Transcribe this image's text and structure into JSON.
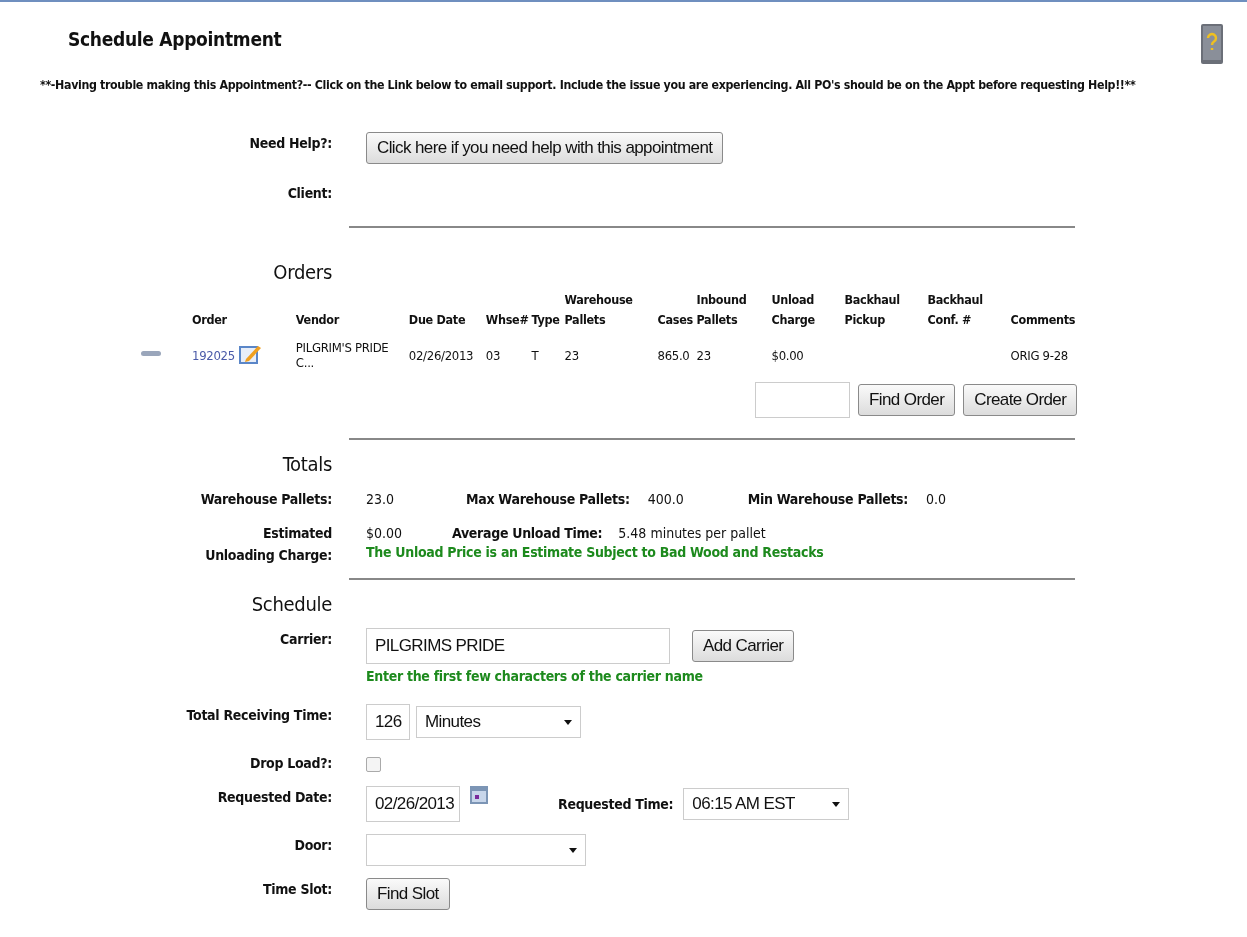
{
  "title": "Schedule Appointment",
  "help_text": "**-Having trouble making this Appointment?-- Click on the Link below to email support. Include the issue you are experiencing. All PO's should be on the Appt before requesting Help!!**",
  "need_help": {
    "label": "Need Help?:",
    "button": "Click here if you need help with this appointment"
  },
  "client": {
    "label": "Client:"
  },
  "orders": {
    "heading": "Orders",
    "columns": [
      "Order",
      "",
      "Vendor",
      "Due Date",
      "Whse#",
      "Type",
      "Warehouse Pallets",
      "Cases",
      "Inbound Pallets",
      "Unload Charge",
      "Backhaul Pickup",
      "Backhaul Conf. #",
      "Comments"
    ],
    "rows": [
      {
        "order": "192025",
        "vendor": "PILGRIM'S PRIDE C...",
        "due_date": "02/26/2013",
        "whse": "03",
        "type": "T",
        "warehouse_pallets": "23",
        "cases": "865.0",
        "inbound_pallets": "23",
        "unload_charge": "$0.00",
        "comments": "ORIG 9-28"
      }
    ],
    "buttons": [
      "Find Order",
      "Create Order"
    ]
  },
  "totals": {
    "heading": "Totals",
    "warehouse_pallets": {
      "label": "Warehouse Pallets:",
      "value": "23.0"
    },
    "max_pallets": {
      "label": "Max Warehouse Pallets:",
      "value": "400.0"
    },
    "min_pallets": {
      "label": "Min Warehouse Pallets:",
      "value": "0.0"
    },
    "unloading_charge": {
      "label": "Estimated Unloading Charge:",
      "value": "$0.00"
    },
    "avg_unload_time": {
      "label": "Average Unload Time:",
      "value": "5.48 minutes per pallet"
    },
    "note": "The Unload Price is an Estimate Subject to Bad Wood and Restacks"
  },
  "schedule": {
    "heading": "Schedule",
    "carrier": {
      "label": "Carrier:",
      "value": "PILGRIMS PRIDE",
      "button": "Add Carrier",
      "hint": "Enter the first few characters of the carrier name"
    },
    "receiving_time": {
      "label": "Total Receiving Time:",
      "value": "126",
      "unit": "Minutes"
    },
    "drop_load": {
      "label": "Drop Load?:",
      "checked": false
    },
    "requested_date": {
      "label": "Requested Date:",
      "value": "02/26/2013"
    },
    "requested_time": {
      "label": "Requested Time:",
      "value": "06:15 AM EST"
    },
    "door": {
      "label": "Door:"
    },
    "time_slot": {
      "label": "Time Slot:",
      "button": "Find Slot"
    }
  }
}
